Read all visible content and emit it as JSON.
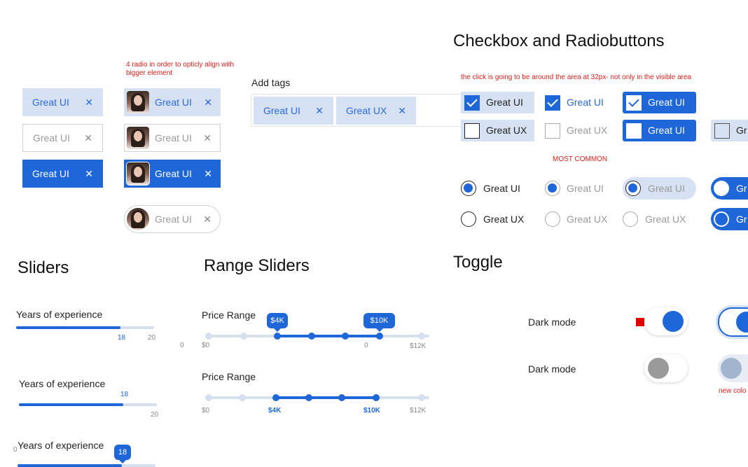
{
  "chips": {
    "note": "4 radio in order to opticly align with bigger element",
    "label": "Great UI",
    "close": "✕"
  },
  "tags": {
    "title": "Add tags",
    "items": [
      "Great UI",
      "Great UX"
    ],
    "close": "✕"
  },
  "checkbox": {
    "title": "Checkbox and Radiobuttons",
    "note": "the click is going to be around the area at 32px- not only in the visible area",
    "most_common": "MOST COMMON",
    "opt1": "Great UI",
    "opt2": "Great UX",
    "cut": "Gr"
  },
  "sliders": {
    "title": "Sliders",
    "label": "Years of experience",
    "value": "18",
    "max": "20",
    "min": "0",
    "level": 0.9
  },
  "range": {
    "title": "Range Sliders",
    "label": "Price Range",
    "low": "$4K",
    "high": "$10K",
    "min": "$0",
    "max": "$12K",
    "zero": "0"
  },
  "toggle": {
    "title": "Toggle",
    "label": "Dark mode",
    "note": "new colo"
  },
  "colors": {
    "accent": "#1f67d9",
    "light": "#d6e1f3",
    "note": "#d9201b"
  }
}
